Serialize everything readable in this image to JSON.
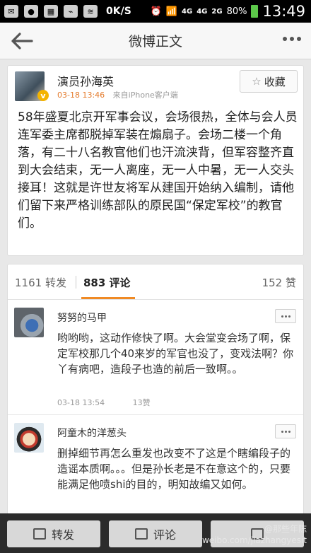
{
  "status_bar": {
    "speed": "0K/S",
    "network_1": "4G",
    "network_2": "4G",
    "network_3": "2G",
    "battery": "80%",
    "time": "13:49"
  },
  "header": {
    "title": "微博正文"
  },
  "post": {
    "author": "演员孙海英",
    "time": "03-18 13:46",
    "source": "来自iPhone客户端",
    "favorite_label": "收藏",
    "body": "58年盛夏北京开军事会议，会场很热，全体与会人员连军委主席都脱掉军装在煽扇子。会场二楼一个角落，有二十八名教官他们也汗流浃背，但军容整齐直到大会结束，无一人离座，无一人中暑，无一人交头接耳！这就是许世友将军从建国开始纳入编制，请他们留下来严格训练部队的原民国“保定军校”的教官们。"
  },
  "stats": {
    "reposts": "1161 转发",
    "comments": "883 评论",
    "likes": "152 赞"
  },
  "comments": [
    {
      "name": "努努的马甲",
      "text": "哟哟哟，这动作修快了啊。大会堂变会场了啊，保定军校那几个40来岁的军官也没了，变戏法啊？你丫有病吧，造段子也造的前后一致啊。。",
      "time": "03-18 13:54",
      "likes": "13赞"
    },
    {
      "name": "阿童木的洋葱头",
      "text": "删掉细节再怎么重发也改变不了这是个瞎编段子的造谣本质啊。。。但是孙长老是不在意这个的，只要能满足他喷shi的目的，明知故编又如何。"
    }
  ],
  "toolbar": {
    "repost_label": "转发",
    "comment_label": "评论",
    "watermark_line1": "@那些年陈",
    "watermark_line2": "weibo.com/jiazhangyesit"
  }
}
